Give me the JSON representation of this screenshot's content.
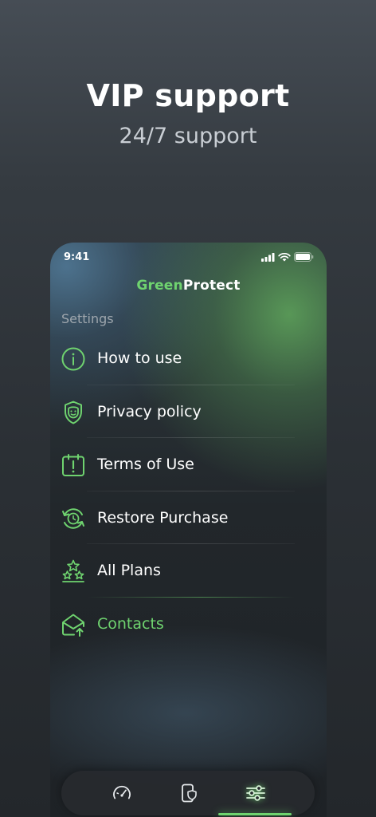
{
  "promo": {
    "title": "VIP support",
    "subtitle": "24/7 support"
  },
  "status_bar": {
    "time": "9:41"
  },
  "brand": {
    "part1": "Green",
    "part2": "Protect"
  },
  "settings": {
    "section_label": "Settings",
    "items": [
      {
        "label": "How to use",
        "icon": "info-circle-icon"
      },
      {
        "label": "Privacy policy",
        "icon": "shield-face-icon"
      },
      {
        "label": "Terms of Use",
        "icon": "calendar-alert-icon"
      },
      {
        "label": "Restore Purchase",
        "icon": "restore-clock-icon"
      },
      {
        "label": "All Plans",
        "icon": "stars-pyramid-icon"
      },
      {
        "label": "Contacts",
        "icon": "envelope-upload-icon"
      }
    ]
  },
  "tabbar": {
    "tabs": [
      {
        "icon": "speedometer-icon"
      },
      {
        "icon": "phone-shield-icon"
      },
      {
        "icon": "sliders-icon"
      }
    ],
    "active_index": 2
  },
  "colors": {
    "accent": "#6fd36f",
    "text_primary": "#ffffff",
    "text_muted": "#9ea6ad"
  }
}
